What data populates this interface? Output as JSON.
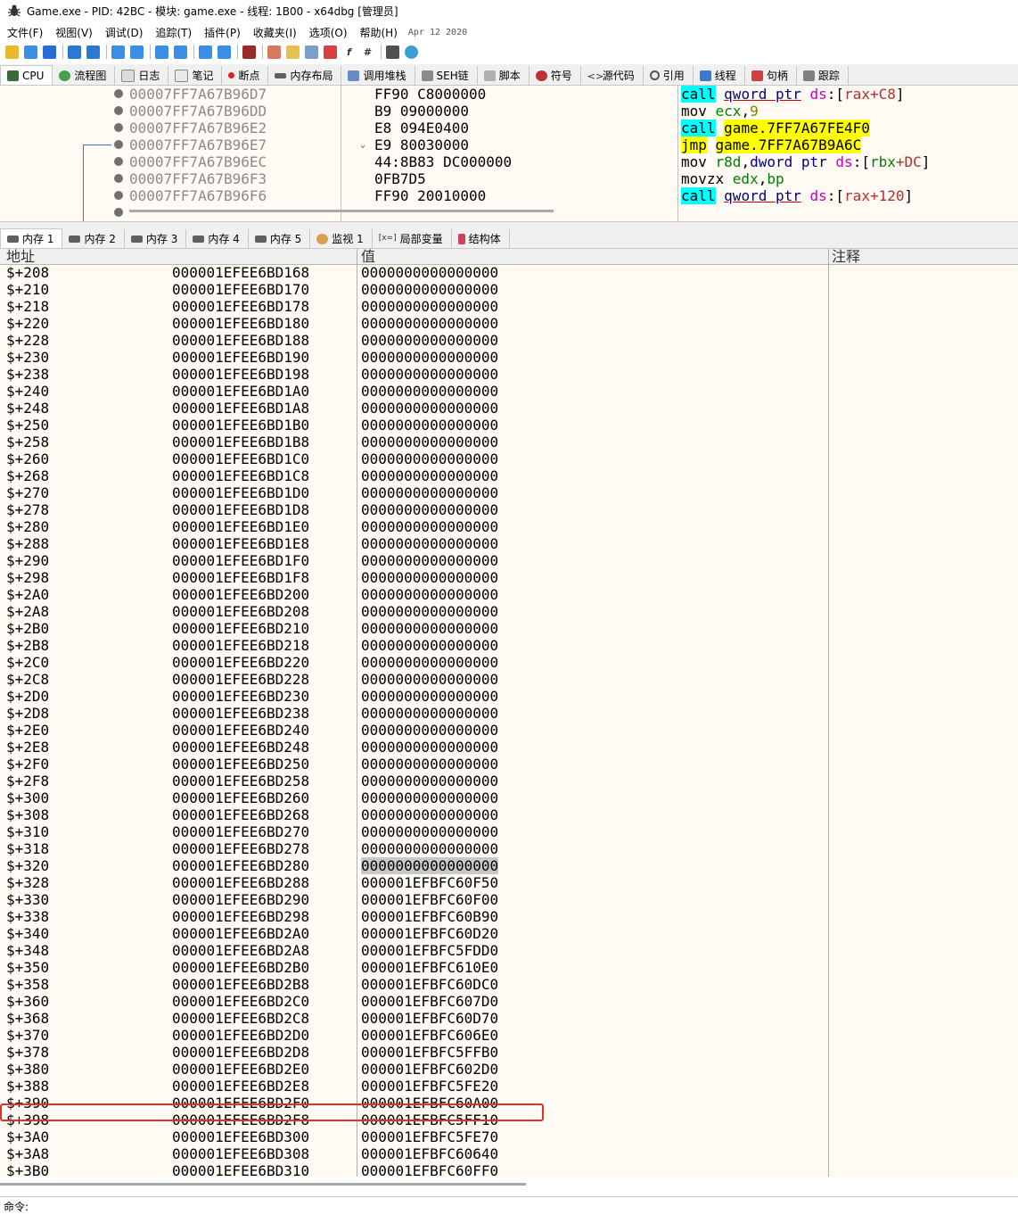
{
  "window": {
    "title": "Game.exe - PID: 42BC - 模块: game.exe - 线程: 1B00 - x64dbg [管理员]"
  },
  "menu": {
    "items": [
      "文件(F)",
      "视图(V)",
      "调试(D)",
      "追踪(T)",
      "插件(P)",
      "收藏夹(I)",
      "选项(O)",
      "帮助(H)"
    ],
    "date": "Apr 12 2020"
  },
  "top_tabs": [
    "CPU",
    "流程图",
    "日志",
    "笔记",
    "断点",
    "内存布局",
    "调用堆栈",
    "SEH链",
    "脚本",
    "符号",
    "源代码",
    "引用",
    "线程",
    "句柄",
    "跟踪"
  ],
  "disasm": {
    "rows": [
      {
        "addr": "00007FF7A67B96D7",
        "bytes": "FF90 C8000000",
        "instr": "call qword ptr ds:[rax+C8]"
      },
      {
        "addr": "00007FF7A67B96DD",
        "bytes": "B9 09000000",
        "instr": "mov ecx,9"
      },
      {
        "addr": "00007FF7A67B96E2",
        "bytes": "E8 094E0400",
        "instr": "call game.7FF7A67FE4F0"
      },
      {
        "addr": "00007FF7A67B96E7",
        "bytes": "E9 80030000",
        "instr": "jmp game.7FF7A67B9A6C"
      },
      {
        "addr": "00007FF7A67B96EC",
        "bytes": "44:8B83 DC000000",
        "instr": "mov r8d,dword ptr ds:[rbx+DC]"
      },
      {
        "addr": "00007FF7A67B96F3",
        "bytes": "0FB7D5",
        "instr": "movzx edx,bp"
      },
      {
        "addr": "00007FF7A67B96F6",
        "bytes": "FF90 20010000",
        "instr": "call qword ptr ds:[rax+120]"
      }
    ]
  },
  "bottom_tabs": [
    "内存 1",
    "内存 2",
    "内存 3",
    "内存 4",
    "内存 5",
    "监视 1",
    "局部变量",
    "结构体"
  ],
  "memory": {
    "headers": {
      "address": "地址",
      "value": "值",
      "comment": "注释"
    },
    "rows": [
      [
        "$+208",
        "000001EFEE6BD168",
        "0000000000000000"
      ],
      [
        "$+210",
        "000001EFEE6BD170",
        "0000000000000000"
      ],
      [
        "$+218",
        "000001EFEE6BD178",
        "0000000000000000"
      ],
      [
        "$+220",
        "000001EFEE6BD180",
        "0000000000000000"
      ],
      [
        "$+228",
        "000001EFEE6BD188",
        "0000000000000000"
      ],
      [
        "$+230",
        "000001EFEE6BD190",
        "0000000000000000"
      ],
      [
        "$+238",
        "000001EFEE6BD198",
        "0000000000000000"
      ],
      [
        "$+240",
        "000001EFEE6BD1A0",
        "0000000000000000"
      ],
      [
        "$+248",
        "000001EFEE6BD1A8",
        "0000000000000000"
      ],
      [
        "$+250",
        "000001EFEE6BD1B0",
        "0000000000000000"
      ],
      [
        "$+258",
        "000001EFEE6BD1B8",
        "0000000000000000"
      ],
      [
        "$+260",
        "000001EFEE6BD1C0",
        "0000000000000000"
      ],
      [
        "$+268",
        "000001EFEE6BD1C8",
        "0000000000000000"
      ],
      [
        "$+270",
        "000001EFEE6BD1D0",
        "0000000000000000"
      ],
      [
        "$+278",
        "000001EFEE6BD1D8",
        "0000000000000000"
      ],
      [
        "$+280",
        "000001EFEE6BD1E0",
        "0000000000000000"
      ],
      [
        "$+288",
        "000001EFEE6BD1E8",
        "0000000000000000"
      ],
      [
        "$+290",
        "000001EFEE6BD1F0",
        "0000000000000000"
      ],
      [
        "$+298",
        "000001EFEE6BD1F8",
        "0000000000000000"
      ],
      [
        "$+2A0",
        "000001EFEE6BD200",
        "0000000000000000"
      ],
      [
        "$+2A8",
        "000001EFEE6BD208",
        "0000000000000000"
      ],
      [
        "$+2B0",
        "000001EFEE6BD210",
        "0000000000000000"
      ],
      [
        "$+2B8",
        "000001EFEE6BD218",
        "0000000000000000"
      ],
      [
        "$+2C0",
        "000001EFEE6BD220",
        "0000000000000000"
      ],
      [
        "$+2C8",
        "000001EFEE6BD228",
        "0000000000000000"
      ],
      [
        "$+2D0",
        "000001EFEE6BD230",
        "0000000000000000"
      ],
      [
        "$+2D8",
        "000001EFEE6BD238",
        "0000000000000000"
      ],
      [
        "$+2E0",
        "000001EFEE6BD240",
        "0000000000000000"
      ],
      [
        "$+2E8",
        "000001EFEE6BD248",
        "0000000000000000"
      ],
      [
        "$+2F0",
        "000001EFEE6BD250",
        "0000000000000000"
      ],
      [
        "$+2F8",
        "000001EFEE6BD258",
        "0000000000000000"
      ],
      [
        "$+300",
        "000001EFEE6BD260",
        "0000000000000000"
      ],
      [
        "$+308",
        "000001EFEE6BD268",
        "0000000000000000"
      ],
      [
        "$+310",
        "000001EFEE6BD270",
        "0000000000000000"
      ],
      [
        "$+318",
        "000001EFEE6BD278",
        "0000000000000000"
      ],
      [
        "$+320",
        "000001EFEE6BD280",
        "0000000000000000"
      ],
      [
        "$+328",
        "000001EFEE6BD288",
        "000001EFBFC60F50"
      ],
      [
        "$+330",
        "000001EFEE6BD290",
        "000001EFBFC60F00"
      ],
      [
        "$+338",
        "000001EFEE6BD298",
        "000001EFBFC60B90"
      ],
      [
        "$+340",
        "000001EFEE6BD2A0",
        "000001EFBFC60D20"
      ],
      [
        "$+348",
        "000001EFEE6BD2A8",
        "000001EFBFC5FDD0"
      ],
      [
        "$+350",
        "000001EFEE6BD2B0",
        "000001EFBFC610E0"
      ],
      [
        "$+358",
        "000001EFEE6BD2B8",
        "000001EFBFC60DC0"
      ],
      [
        "$+360",
        "000001EFEE6BD2C0",
        "000001EFBFC607D0"
      ],
      [
        "$+368",
        "000001EFEE6BD2C8",
        "000001EFBFC60D70"
      ],
      [
        "$+370",
        "000001EFEE6BD2D0",
        "000001EFBFC606E0"
      ],
      [
        "$+378",
        "000001EFEE6BD2D8",
        "000001EFBFC5FFB0"
      ],
      [
        "$+380",
        "000001EFEE6BD2E0",
        "000001EFBFC602D0"
      ],
      [
        "$+388",
        "000001EFEE6BD2E8",
        "000001EFBFC5FE20"
      ],
      [
        "$+390",
        "000001EFEE6BD2F0",
        "000001EFBFC60A00"
      ],
      [
        "$+398",
        "000001EFEE6BD2F8",
        "000001EFBFC5FF10"
      ],
      [
        "$+3A0",
        "000001EFEE6BD300",
        "000001EFBFC5FE70"
      ],
      [
        "$+3A8",
        "000001EFEE6BD308",
        "000001EFBFC60640"
      ],
      [
        "$+3B0",
        "000001EFEE6BD310",
        "000001EFBFC60FF0"
      ]
    ],
    "selected_index": 35
  },
  "command": {
    "label": "命令:"
  },
  "colors": {
    "panel_bg": "#fffaf4",
    "call_highlight": "#00ffff",
    "jmp_highlight": "#ffff00",
    "selection_box": "#e0302a"
  }
}
